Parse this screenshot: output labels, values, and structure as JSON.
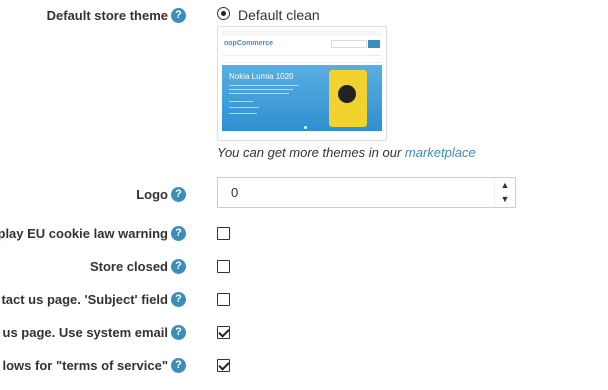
{
  "theme": {
    "label": "Default store theme",
    "option_label": "Default clean",
    "preview": {
      "logo": "nopCommerce",
      "banner_title": "Nokia Lumia 1020"
    },
    "note_prefix": "You can get more themes in our ",
    "note_link": "marketplace"
  },
  "logo": {
    "label": "Logo",
    "value": "0"
  },
  "settings": [
    {
      "label": "play EU cookie law warning",
      "checked": false
    },
    {
      "label": "Store closed",
      "checked": false
    },
    {
      "label": "tact us page. 'Subject' field",
      "checked": false
    },
    {
      "label": "t us page. Use system email",
      "checked": true
    },
    {
      "label": "lows for \"terms of service\"",
      "checked": true
    }
  ],
  "help_icon_glyph": "?",
  "colors": {
    "accent": "#3c8dbc",
    "banner": "#2f8fd0",
    "phone": "#f1d22e"
  }
}
